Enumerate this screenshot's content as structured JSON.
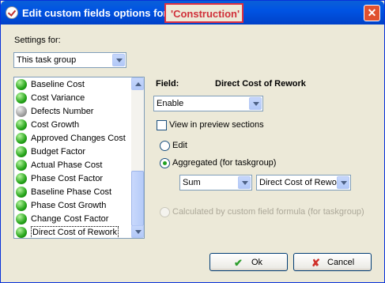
{
  "window": {
    "title_prefix": "Edit custom fields options for",
    "title_highlight": "'Construction'",
    "close_glyph": "✕"
  },
  "settings": {
    "label": "Settings for:",
    "selected": "This task group"
  },
  "fields_list": {
    "items": [
      {
        "label": "Baseline Cost",
        "status": "green"
      },
      {
        "label": "Cost Variance",
        "status": "green"
      },
      {
        "label": "Defects Number",
        "status": "grey"
      },
      {
        "label": "Cost Growth",
        "status": "green"
      },
      {
        "label": "Approved Changes Cost",
        "status": "green"
      },
      {
        "label": "Budget Factor",
        "status": "green"
      },
      {
        "label": "Actual Phase Cost",
        "status": "green"
      },
      {
        "label": "Phase Cost Factor",
        "status": "green"
      },
      {
        "label": "Baseline Phase Cost",
        "status": "green"
      },
      {
        "label": "Phase Cost Growth",
        "status": "green"
      },
      {
        "label": "Change Cost Factor",
        "status": "green"
      },
      {
        "label": "Direct Cost of Rework",
        "status": "green",
        "selected": true
      }
    ]
  },
  "field": {
    "label": "Field:",
    "name": "Direct Cost of Rework",
    "enable_selected": "Enable",
    "view_preview_label": "View in preview sections",
    "view_preview_checked": false,
    "mode_options": {
      "edit": "Edit",
      "aggregated": "Aggregated (for taskgroup)",
      "calculated": "Calculated by custom field formula (for taskgroup)"
    },
    "selected_mode": "aggregated",
    "aggregate_function": "Sum",
    "aggregate_source": "Direct Cost of Rewo"
  },
  "buttons": {
    "ok_label": "Ok",
    "cancel_label": "Cancel"
  },
  "colors": {
    "titlebar": "#0054e3",
    "highlight_border": "#e03040",
    "status_green": "#26a51a",
    "status_grey": "#a0a0a0"
  }
}
